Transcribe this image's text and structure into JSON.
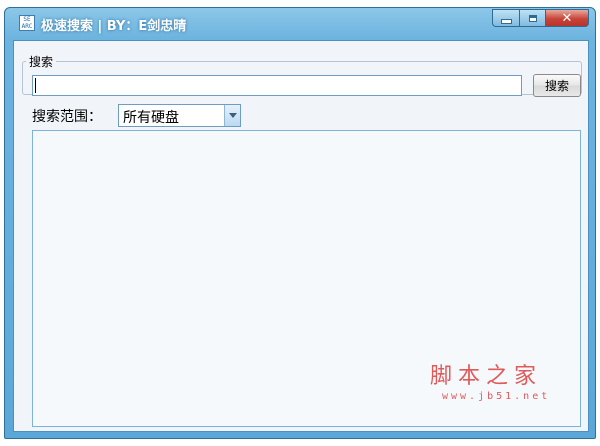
{
  "window": {
    "title": "极速搜索 | BY：E剑忠晴",
    "icon": "app-search-icon",
    "controls": {
      "minimize": "minimize-icon",
      "maximize": "maximize-icon",
      "close": "close-icon"
    },
    "close_label": "✕"
  },
  "search_group": {
    "label": "搜索",
    "input_value": "",
    "button_label": "搜索"
  },
  "scope": {
    "label": "搜索范围：",
    "selected": "所有硬盘"
  },
  "results": [],
  "watermark": {
    "brand": "脚本之家",
    "url": "www.jb51.net"
  },
  "colors": {
    "frame": "#6db4df",
    "client_bg": "#f1f5fa",
    "close": "#c8453a",
    "watermark": "#e05a5a"
  }
}
